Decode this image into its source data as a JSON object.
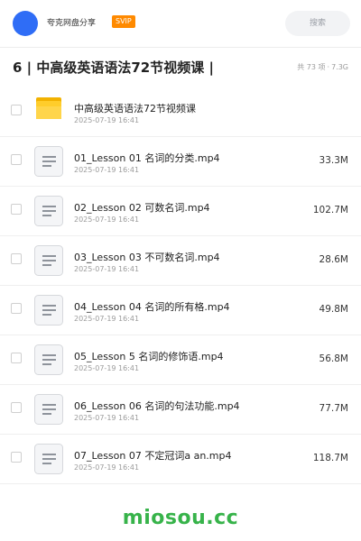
{
  "header": {
    "share_name": "夸克网盘分享",
    "badge": "SVIP",
    "search_placeholder": "搜索",
    "avatar_color": "#2f6df6",
    "badge_color": "#ff8a00"
  },
  "title_bar": {
    "title": "6 | 中高级英语语法72节视频课 |",
    "count": "共 73 项",
    "size": "7.3G"
  },
  "files": [
    {
      "type": "folder",
      "icon": "folder-icon",
      "name": "中高级英语语法72节视频课",
      "date": "2025-07-19 16:41",
      "size": ""
    },
    {
      "type": "file",
      "icon": "document-icon",
      "name": "01_Lesson 01 名词的分类.mp4",
      "date": "2025-07-19 16:41",
      "size": "33.3M"
    },
    {
      "type": "file",
      "icon": "document-icon",
      "name": "02_Lesson 02 可数名词.mp4",
      "date": "2025-07-19 16:41",
      "size": "102.7M"
    },
    {
      "type": "file",
      "icon": "document-icon",
      "name": "03_Lesson 03 不可数名词.mp4",
      "date": "2025-07-19 16:41",
      "size": "28.6M"
    },
    {
      "type": "file",
      "icon": "document-icon",
      "name": "04_Lesson 04 名词的所有格.mp4",
      "date": "2025-07-19 16:41",
      "size": "49.8M"
    },
    {
      "type": "file",
      "icon": "document-icon",
      "name": "05_Lesson 5 名词的修饰语.mp4",
      "date": "2025-07-19 16:41",
      "size": "56.8M"
    },
    {
      "type": "file",
      "icon": "document-icon",
      "name": "06_Lesson 06 名词的句法功能.mp4",
      "date": "2025-07-19 16:41",
      "size": "77.7M"
    },
    {
      "type": "file",
      "icon": "document-icon",
      "name": "07_Lesson 07 不定冠词a an.mp4",
      "date": "2025-07-19 16:41",
      "size": "118.7M"
    }
  ],
  "watermark": "miosou.cc",
  "watermark_color": "#37b34a"
}
